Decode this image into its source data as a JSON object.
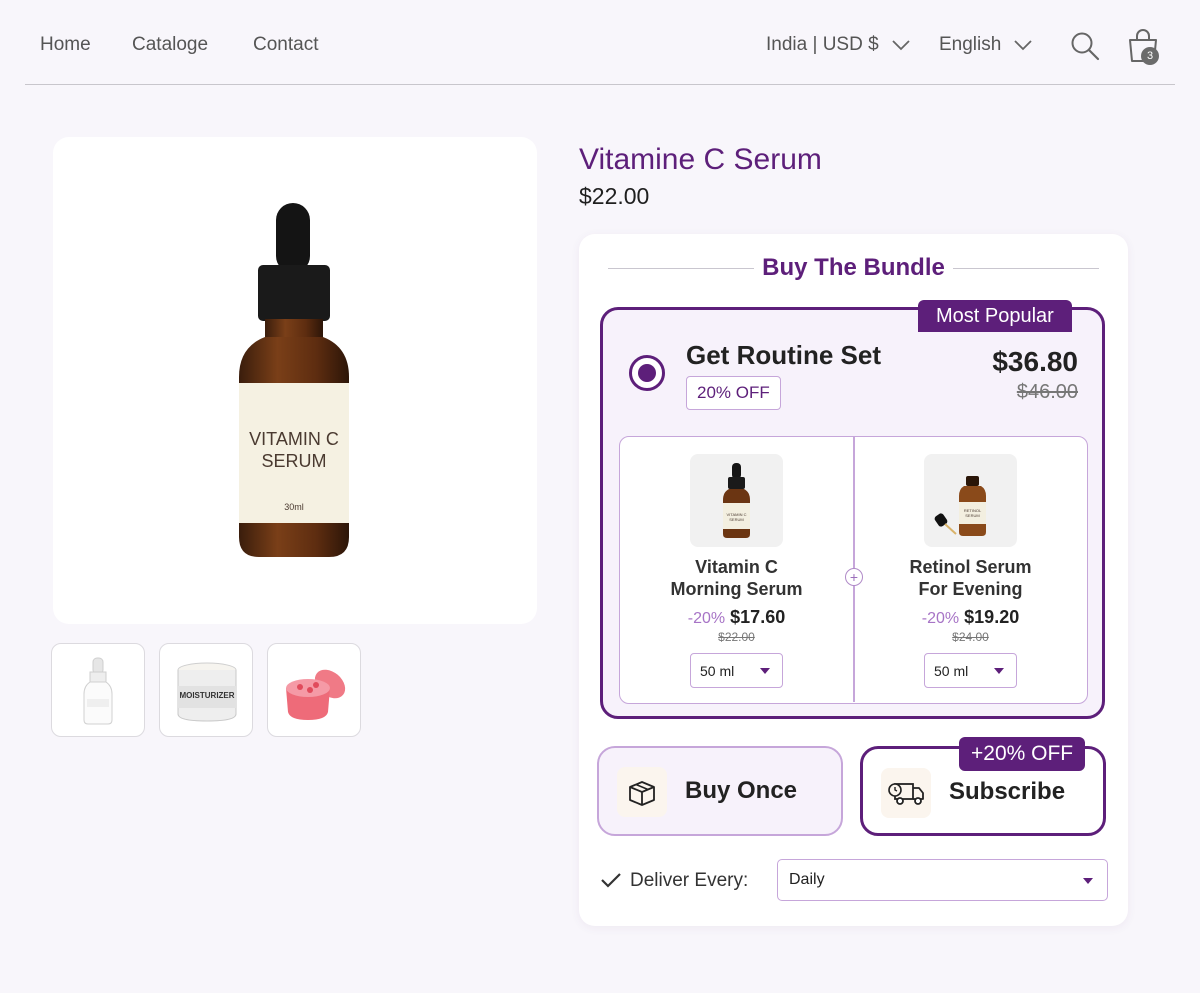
{
  "nav": {
    "links": [
      "Home",
      "Cataloge",
      "Contact"
    ],
    "region": "India | USD $",
    "language": "English",
    "cart_count": "3",
    "icons": [
      "chevron-down-icon",
      "search-icon",
      "shopping-bag-icon"
    ]
  },
  "product": {
    "title": "Vitamine C Serum",
    "price": "$22.00",
    "main_image": {
      "label_line1": "VITAMIN C",
      "label_line2": "SERUM",
      "volume": "30ml"
    },
    "thumbnails": [
      {
        "name": "serum-bottle"
      },
      {
        "name": "moisturizer-jar",
        "label": "MOISTURIZER"
      },
      {
        "name": "pink-scrub-jar"
      }
    ]
  },
  "bundle": {
    "heading": "Buy The Bundle",
    "badge": "Most Popular",
    "set_name": "Get Routine Set",
    "discount_label": "20% OFF",
    "price": "$36.80",
    "old_price": "$46.00",
    "items": [
      {
        "name_line1": "Vitamin C",
        "name_line2": "Morning Serum",
        "discount": "-20%",
        "price": "$17.60",
        "old_price": "$22.00",
        "size": "50 ml"
      },
      {
        "name_line1": "Retinol Serum",
        "name_line2": "For Evening",
        "discount": "-20%",
        "price": "$19.20",
        "old_price": "$24.00",
        "size": "50 ml"
      }
    ]
  },
  "purchase": {
    "buy_once": "Buy Once",
    "subscribe": "Subscribe",
    "subscribe_badge": "+20% OFF",
    "deliver_label": "Deliver Every:",
    "deliver_value": "Daily"
  },
  "colors": {
    "accent": "#5d1f7a",
    "accent_light": "#c6a6da",
    "background": "#f8f6fb"
  }
}
